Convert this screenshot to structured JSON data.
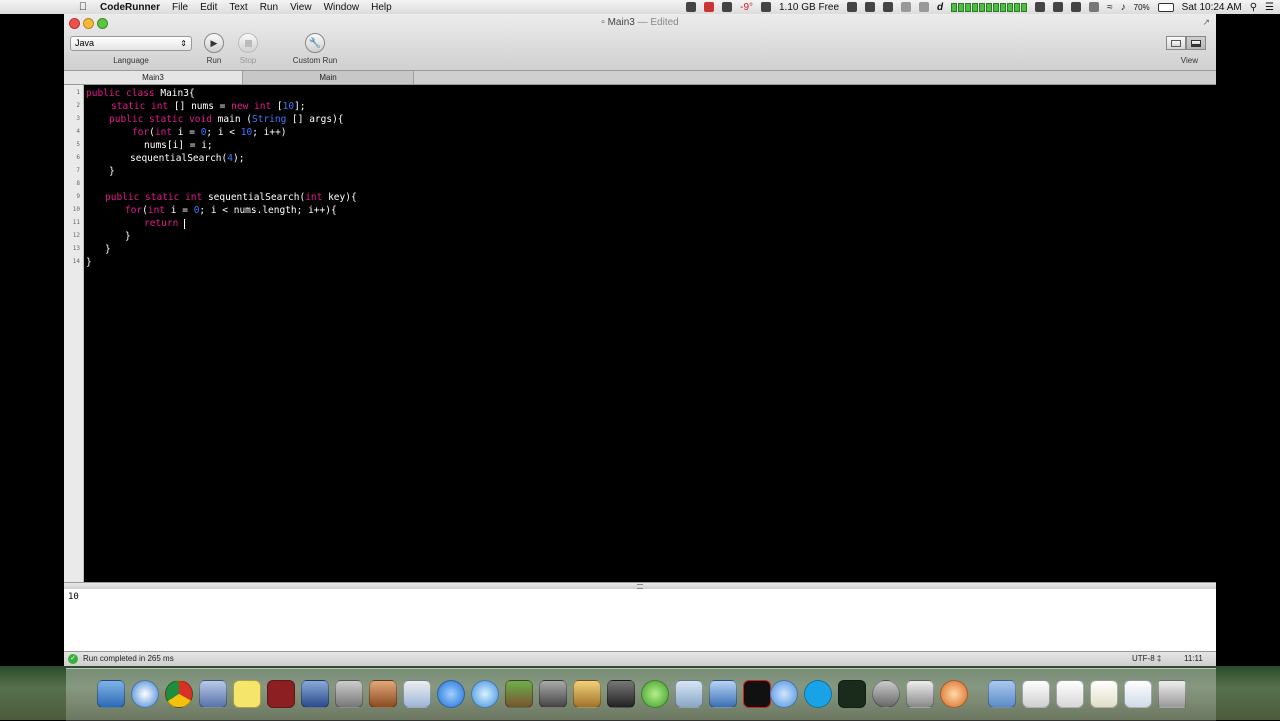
{
  "menubar": {
    "app_name": "CodeRunner",
    "menus": [
      "File",
      "Edit",
      "Text",
      "Run",
      "View",
      "Window",
      "Help"
    ],
    "temperature": "-9°",
    "disk_free": "1.10 GB Free",
    "battery": "70%",
    "clock": "Sat 10:24 AM"
  },
  "window": {
    "title": "Main3",
    "edited": "— Edited"
  },
  "toolbar": {
    "language_value": "Java",
    "language_label": "Language",
    "run_label": "Run",
    "stop_label": "Stop",
    "custom_run_label": "Custom Run",
    "view_label": "View"
  },
  "tabs": [
    {
      "label": "Main3",
      "active": true
    },
    {
      "label": "Main",
      "active": false
    }
  ],
  "editor": {
    "line_numbers": [
      "1",
      "2",
      "3",
      "4",
      "5",
      "6",
      "7",
      "8",
      "9",
      "10",
      "11",
      "12",
      "13",
      "14"
    ]
  },
  "console": {
    "output": "10"
  },
  "status": {
    "message": "Run completed in 265 ms",
    "encoding": "UTF-8 ‡",
    "cursor_position": "11:11"
  },
  "colors": {
    "keyword": "#e6198c",
    "type": "#3d7bff",
    "success": "#37b03a"
  }
}
